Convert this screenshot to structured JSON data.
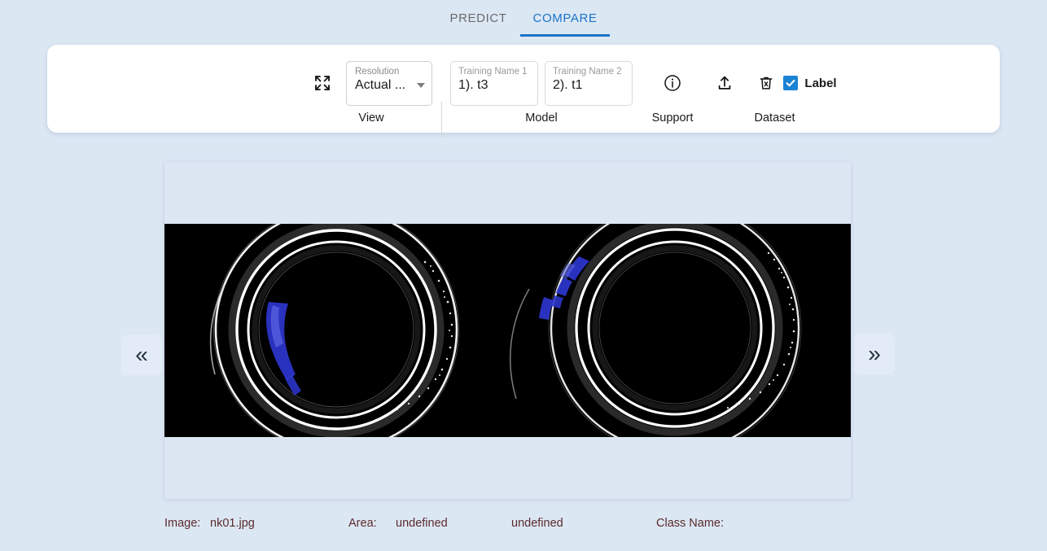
{
  "tabs": [
    {
      "label": "PREDICT",
      "active": false
    },
    {
      "label": "COMPARE",
      "active": true
    }
  ],
  "toolbar": {
    "groups": {
      "view": {
        "label": "View",
        "fullscreen_icon": "fullscreen-expand-icon",
        "resolution": {
          "label": "Resolution",
          "value": "Actual ...",
          "caret_icon": "chevron-down-icon"
        }
      },
      "model": {
        "label": "Model",
        "fields": [
          {
            "label": "Training Name 1",
            "value": "1). t3"
          },
          {
            "label": "Training Name 2",
            "value": "2). t1"
          }
        ]
      },
      "support": {
        "label": "Support",
        "info_icon": "info-circle-icon"
      },
      "dataset": {
        "label": "Dataset",
        "upload_icon": "upload-icon",
        "delete_icon": "delete-trash-x-icon",
        "checkbox": {
          "label": "Label",
          "checked": true
        }
      }
    }
  },
  "viewer": {
    "prev_label": "«",
    "next_label": "»",
    "prev_icon": "chevron-double-left-icon",
    "next_icon": "chevron-double-right-icon",
    "left_image_alt": "bearing-ring-ground-truth",
    "right_image_alt": "bearing-ring-prediction"
  },
  "info": {
    "image_key": "Image:",
    "image_value": "nk01.jpg",
    "area_key": "Area:",
    "area_value_1": "undefined",
    "area_value_2": "undefined",
    "class_key": "Class Name:"
  },
  "colors": {
    "page_background": "#dce7f4",
    "accent_blue": "#1a73c8",
    "checkbox_blue": "#1a83d4",
    "annotation_blue": "#2b35c8",
    "info_text": "#5a2a2a"
  }
}
